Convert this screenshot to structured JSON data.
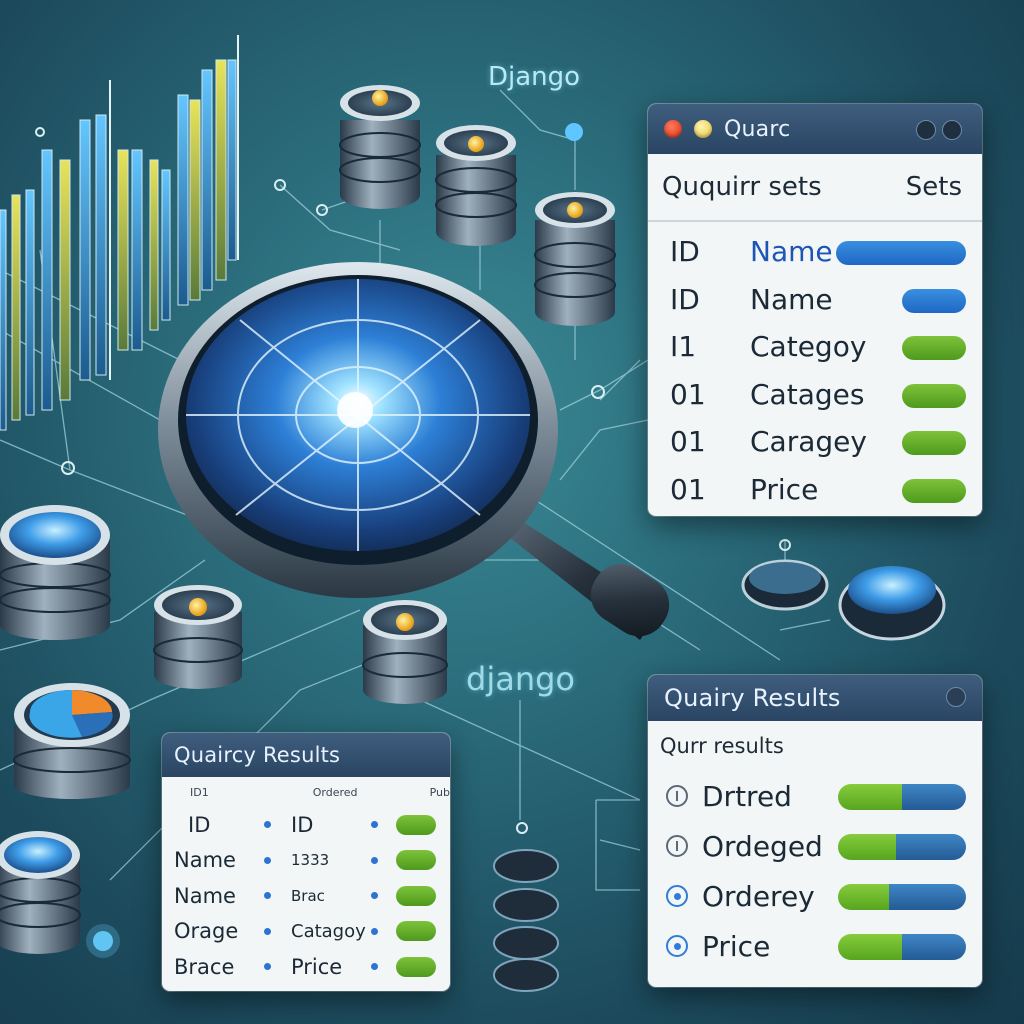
{
  "brand_labels": [
    "Django",
    "django"
  ],
  "query_window": {
    "title": "Quarc",
    "header_left": "Ququirr sets",
    "header_right": "Sets",
    "rows": [
      {
        "id": "ID",
        "field": "Name",
        "bar_color": "#2b7fdc"
      },
      {
        "id": "ID",
        "field": "Name",
        "bar_color": "#2b7fdc"
      },
      {
        "id": "I1",
        "field": "Categoy",
        "bar_color": "#5aa225"
      },
      {
        "id": "01",
        "field": "Catages",
        "bar_color": "#6ab42b"
      },
      {
        "id": "01",
        "field": "Caragey",
        "bar_color": "#6ab42b"
      },
      {
        "id": "01",
        "field": "Price",
        "bar_color": "#6ab42b"
      }
    ]
  },
  "results_left": {
    "title": "Quaircy Results",
    "headers": [
      "ID1",
      "Ordered",
      "Pub"
    ],
    "rows": [
      {
        "a": "ID",
        "b": "ID"
      },
      {
        "a": "Name",
        "b": "1333"
      },
      {
        "a": "Name",
        "b": "Brac"
      },
      {
        "a": "Orage",
        "b": "Catagoy"
      },
      {
        "a": "Brace",
        "b": "Price"
      }
    ]
  },
  "results_right": {
    "title": "Quairy Results",
    "subtitle": "Qurr results",
    "rows": [
      {
        "label": "Drtred",
        "icon": "outline",
        "fill": 0.5
      },
      {
        "label": "Ordeged",
        "icon": "outline",
        "fill": 0.45
      },
      {
        "label": "Orderey",
        "icon": "blue",
        "fill": 0.4
      },
      {
        "label": "Price",
        "icon": "blue",
        "fill": 0.5
      }
    ]
  },
  "colors": {
    "accent_blue": "#2b7fdc",
    "accent_green": "#6ab42b",
    "background": "#2a6b7a"
  }
}
